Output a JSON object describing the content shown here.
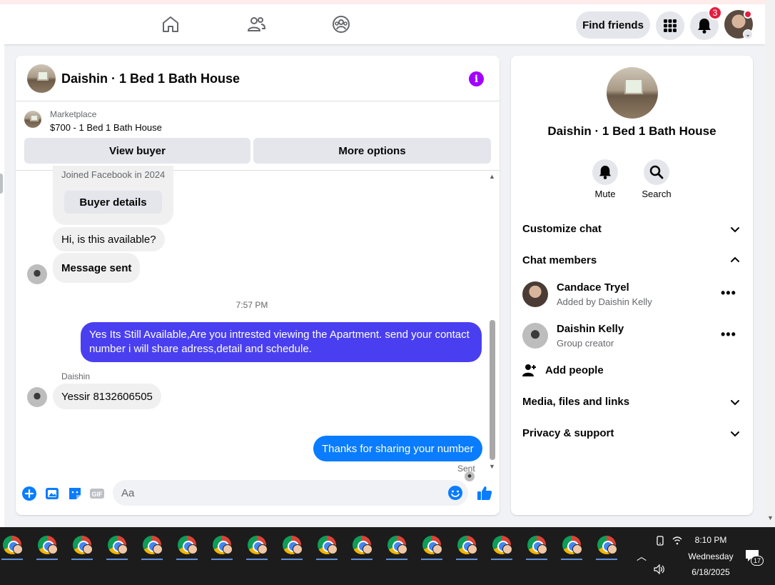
{
  "topbar": {
    "find_friends_label": "Find friends",
    "notification_count": "3",
    "nav_icons": [
      "home-icon",
      "friends-icon",
      "groups-icon"
    ]
  },
  "chat": {
    "title": "Daishin · 1 Bed 1 Bath House",
    "marketplace_label": "Marketplace",
    "listing_price": "$700 - 1 Bed 1 Bath House",
    "view_buyer_label": "View buyer",
    "more_options_label": "More options",
    "messages": {
      "joined_text": "Joined Facebook in 2024",
      "buyer_details_label": "Buyer details",
      "msg1": "Hi, is this available?",
      "msg2": "Message sent",
      "timestamp": "7:57 PM",
      "msg3": "Yes Its Still Available,Are you intrested viewing the Apartment. send your contact number i will share adress,detail and schedule.",
      "sender_name": "Daishin",
      "msg4": "Yessir 8132606505",
      "msg5": "Thanks for sharing your number",
      "status": "Sent"
    },
    "composer_placeholder": "Aa"
  },
  "info_panel": {
    "title": "Daishin · 1 Bed 1 Bath House",
    "mute_label": "Mute",
    "search_label": "Search",
    "customize_label": "Customize chat",
    "members_label": "Chat members",
    "members": [
      {
        "name": "Candace Tryel",
        "sub": "Added by Daishin Kelly"
      },
      {
        "name": "Daishin Kelly",
        "sub": "Group creator"
      }
    ],
    "add_people_label": "Add people",
    "media_label": "Media, files and links",
    "privacy_label": "Privacy & support"
  },
  "taskbar": {
    "time": "8:10 PM",
    "day": "Wednesday",
    "date": "6/18/2025",
    "notification_count": "17"
  },
  "colors": {
    "accent_blue": "#0a7cff",
    "purple_bubble": "#4a3ff0",
    "info_purple": "#a100ff",
    "badge_red": "#e41e3f"
  }
}
